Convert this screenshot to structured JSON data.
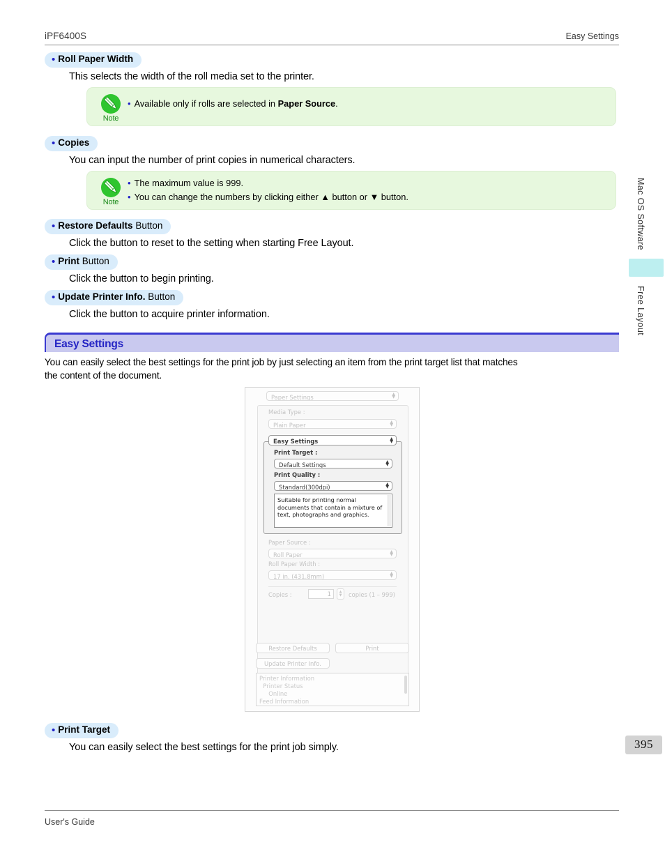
{
  "header": {
    "model": "iPF6400S",
    "section": "Easy Settings"
  },
  "footer": {
    "guide": "User's Guide",
    "page_number": "395"
  },
  "side_tabs": {
    "upper": "Mac OS Software",
    "lower": "Free Layout",
    "highlight_color": "#bdeff0"
  },
  "entries": [
    {
      "bold": "Roll Paper Width",
      "suffix": "",
      "desc": "This selects the width of the roll media set to the printer."
    },
    {
      "bold": "Copies",
      "suffix": "",
      "desc": "You can input the number of print copies in numerical characters."
    },
    {
      "bold": "Restore Defaults",
      "suffix": " Button",
      "desc": "Click the button to reset to the setting when starting Free Layout."
    },
    {
      "bold": "Print",
      "suffix": " Button",
      "desc": "Click the button to begin printing."
    },
    {
      "bold": "Update Printer Info.",
      "suffix": " Button",
      "desc": "Click the button to acquire printer information."
    },
    {
      "bold": "Print Target",
      "suffix": "",
      "desc": "You can easily select the best settings for the print job simply."
    }
  ],
  "notes": {
    "label": "Note",
    "note1": [
      {
        "pre": "Available only if rolls are selected in ",
        "bold": "Paper Source",
        "post": "."
      }
    ],
    "note2": [
      {
        "pre": "The maximum value is 999.",
        "bold": "",
        "post": ""
      },
      {
        "pre": "You can change the numbers by clicking either ▲ button or ▼ button.",
        "bold": "",
        "post": ""
      }
    ]
  },
  "section": {
    "title": "Easy Settings",
    "paragraph_line1": "You can easily select the best settings for the print job by just selecting an item from the print target list that matches",
    "paragraph_line2": "the content of the document.",
    "accent_color": "#3a3ad0",
    "band_color": "#c9c9ef"
  },
  "dialog": {
    "panel_popup": "Paper Settings",
    "media_type_label": "Media Type :",
    "media_type_value": "Plain Paper",
    "settings_mode": "Easy Settings",
    "print_target_label": "Print Target :",
    "print_target_value": "Default Settings",
    "print_quality_label": "Print Quality :",
    "print_quality_value": "Standard(300dpi)",
    "description": "Suitable for printing normal documents that contain a mixture of text, photographs and graphics.",
    "paper_source_label": "Paper Source :",
    "paper_source_value": "Roll Paper",
    "roll_width_label": "Roll Paper Width :",
    "roll_width_value": "17 in. (431.8mm)",
    "copies_label": "Copies :",
    "copies_value": "1",
    "copies_hint": "copies (1 – 999)",
    "btn_restore": "Restore Defaults",
    "btn_print": "Print",
    "btn_update": "Update Printer Info.",
    "info_lines": [
      "Printer Information",
      "  Printer Status",
      "     Online",
      "Feed Information"
    ]
  }
}
